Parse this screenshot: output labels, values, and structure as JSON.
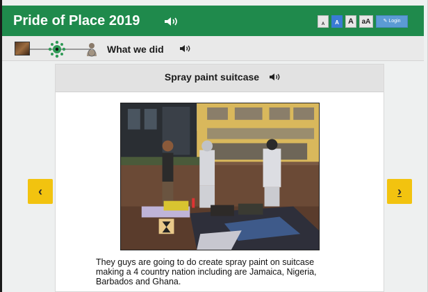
{
  "header": {
    "title": "Pride of Place 2019",
    "title_audio_icon": "speaker-icon",
    "text_size_buttons": [
      "A",
      "A",
      "A",
      "aA"
    ],
    "selected_text_size": "A",
    "login_label": "Login",
    "login_icon": "pencil-icon",
    "colors": {
      "bar": "#1f8a4c",
      "login": "#5b9bd5",
      "size_selected": "#3a7bd5"
    }
  },
  "nav": {
    "breadcrumb_icons": [
      "thumbnail-icon",
      "network-node-icon",
      "person-icon"
    ],
    "section_title": "What we did",
    "section_audio_icon": "speaker-icon"
  },
  "card": {
    "title": "Spray paint suitcase",
    "title_audio_icon": "speaker-icon",
    "caption": "They guys are going to do create spray paint on suitcase making a 4 country nation including are Jamaica, Nigeria, Barbados and Ghana."
  },
  "controls": {
    "prev_label": "‹",
    "next_label": "›",
    "color": "#f2c30f"
  }
}
